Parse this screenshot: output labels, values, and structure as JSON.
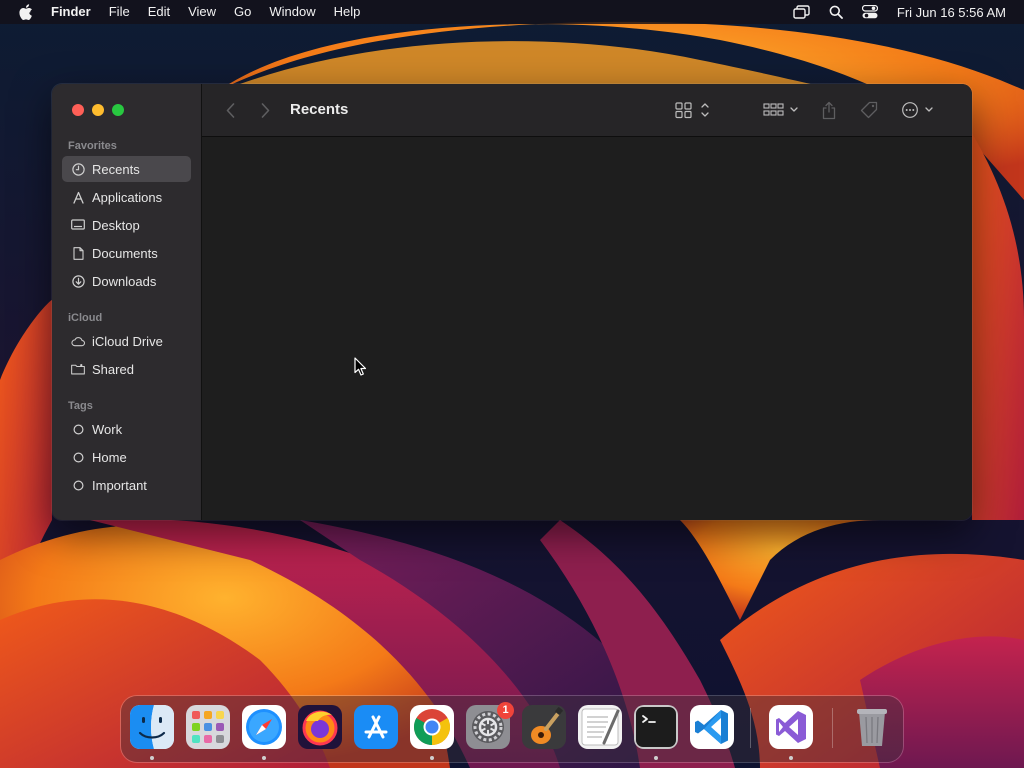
{
  "menubar": {
    "app_name": "Finder",
    "menus": [
      "File",
      "Edit",
      "View",
      "Go",
      "Window",
      "Help"
    ],
    "clock": "Fri Jun 16  5:56 AM"
  },
  "finder": {
    "title": "Recents",
    "sidebar": {
      "favorites_header": "Favorites",
      "favorites": [
        {
          "label": "Recents",
          "icon": "clock-icon",
          "selected": true
        },
        {
          "label": "Applications",
          "icon": "applications-icon"
        },
        {
          "label": "Desktop",
          "icon": "desktop-icon"
        },
        {
          "label": "Documents",
          "icon": "document-icon"
        },
        {
          "label": "Downloads",
          "icon": "download-icon"
        }
      ],
      "icloud_header": "iCloud",
      "icloud": [
        {
          "label": "iCloud Drive",
          "icon": "cloud-icon"
        },
        {
          "label": "Shared",
          "icon": "shared-folder-icon"
        }
      ],
      "tags_header": "Tags",
      "tags": [
        {
          "label": "Work",
          "icon": "tag-circle-icon"
        },
        {
          "label": "Home",
          "icon": "tag-circle-icon"
        },
        {
          "label": "Important",
          "icon": "tag-circle-icon"
        }
      ]
    }
  },
  "dock": {
    "apps": [
      "Finder",
      "Launchpad",
      "Safari",
      "Firefox",
      "App Store",
      "Google Chrome",
      "System Settings",
      "GarageBand",
      "TextEdit",
      "Terminal",
      "Visual Studio Code",
      "Visual Studio",
      "Trash"
    ],
    "system_settings_badge": "1"
  },
  "colors": {
    "window_bg": "#1e1e1e",
    "sidebar_bg": "#2d2b2e",
    "selected_item": "#4a484c",
    "close": "#fe5f57",
    "minimize": "#febc2e",
    "maximize": "#28c840",
    "badge": "#f0443a"
  }
}
